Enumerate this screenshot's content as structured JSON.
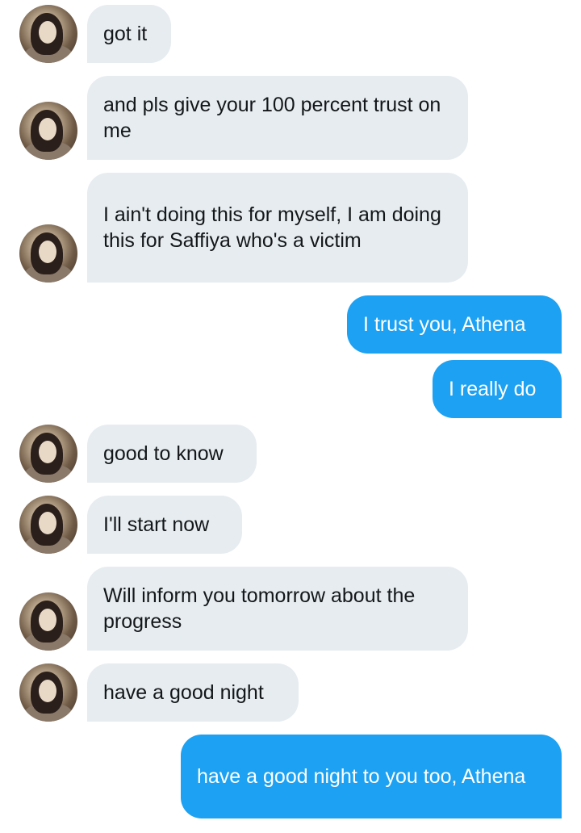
{
  "colors": {
    "incoming_bubble": "#e6ecf0",
    "outgoing_bubble": "#1da1f2",
    "incoming_text": "#14171a",
    "outgoing_text": "#ffffff"
  },
  "messages": [
    {
      "sender": "other",
      "text": "got it"
    },
    {
      "sender": "other",
      "text": "and pls give your 100 percent trust on me"
    },
    {
      "sender": "other",
      "text": "I ain't doing this for myself, I am doing this for Saffiya who's a victim"
    },
    {
      "sender": "me",
      "text": "I trust you, Athena"
    },
    {
      "sender": "me",
      "text": "I really do"
    },
    {
      "sender": "other",
      "text": "good to know"
    },
    {
      "sender": "other",
      "text": "I'll start now"
    },
    {
      "sender": "other",
      "text": "Will inform you tomorrow about the progress"
    },
    {
      "sender": "other",
      "text": "have a good night"
    },
    {
      "sender": "me",
      "text": "have a good night to you too, Athena"
    }
  ]
}
